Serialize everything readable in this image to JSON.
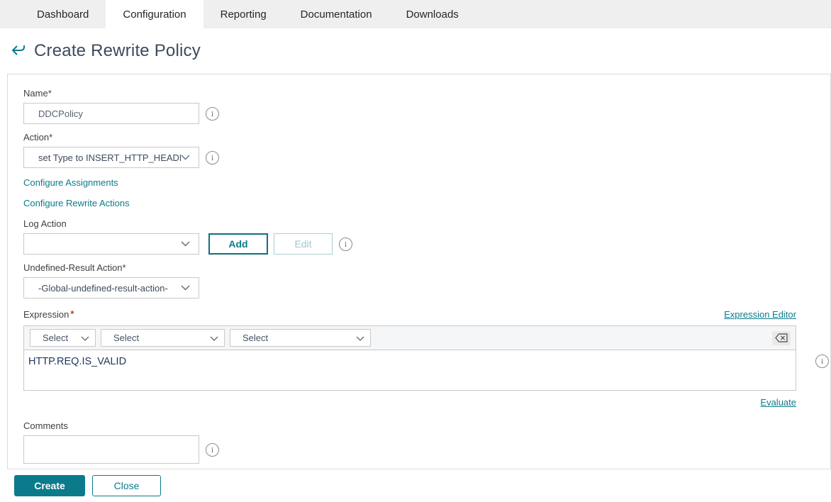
{
  "navbar": {
    "active_tab": "Configuration",
    "tabs": [
      {
        "label": "Dashboard"
      },
      {
        "label": "Configuration"
      },
      {
        "label": "Reporting"
      },
      {
        "label": "Documentation"
      },
      {
        "label": "Downloads"
      }
    ]
  },
  "header": {
    "title": "Create Rewrite Policy"
  },
  "form": {
    "name": {
      "label": "Name",
      "required_mark": "*",
      "value": "DDCPolicy"
    },
    "action": {
      "label": "Action",
      "required_mark": "*",
      "selected": "set Type to INSERT_HTTP_HEADER"
    },
    "configure_assignments_link": "Configure Assignments",
    "configure_rewrite_actions_link": "Configure Rewrite Actions",
    "log_action": {
      "label": "Log Action",
      "selected": "",
      "add_button": "Add",
      "edit_button": "Edit"
    },
    "undefined_result_action": {
      "label": "Undefined-Result Action",
      "required_mark": "*",
      "selected": "-Global-undefined-result-action-"
    },
    "expression": {
      "label": "Expression",
      "required_mark": "*",
      "expression_editor_link": "Expression Editor",
      "select_placeholders": [
        "Select",
        "Select",
        "Select"
      ],
      "value": "HTTP.REQ.IS_VALID",
      "evaluate_link": "Evaluate"
    },
    "comments": {
      "label": "Comments",
      "value": ""
    }
  },
  "actions": {
    "create_button": "Create",
    "close_button": "Close"
  },
  "icons": {
    "info_glyph": "i"
  },
  "colors": {
    "accent_teal": "#0b7b8b",
    "navbar_bg": "#efefef",
    "title_text": "#3b4a5c",
    "expression_text": "#20385f",
    "required_red": "#d0342c",
    "disabled_teal": "#9fc7ce"
  }
}
